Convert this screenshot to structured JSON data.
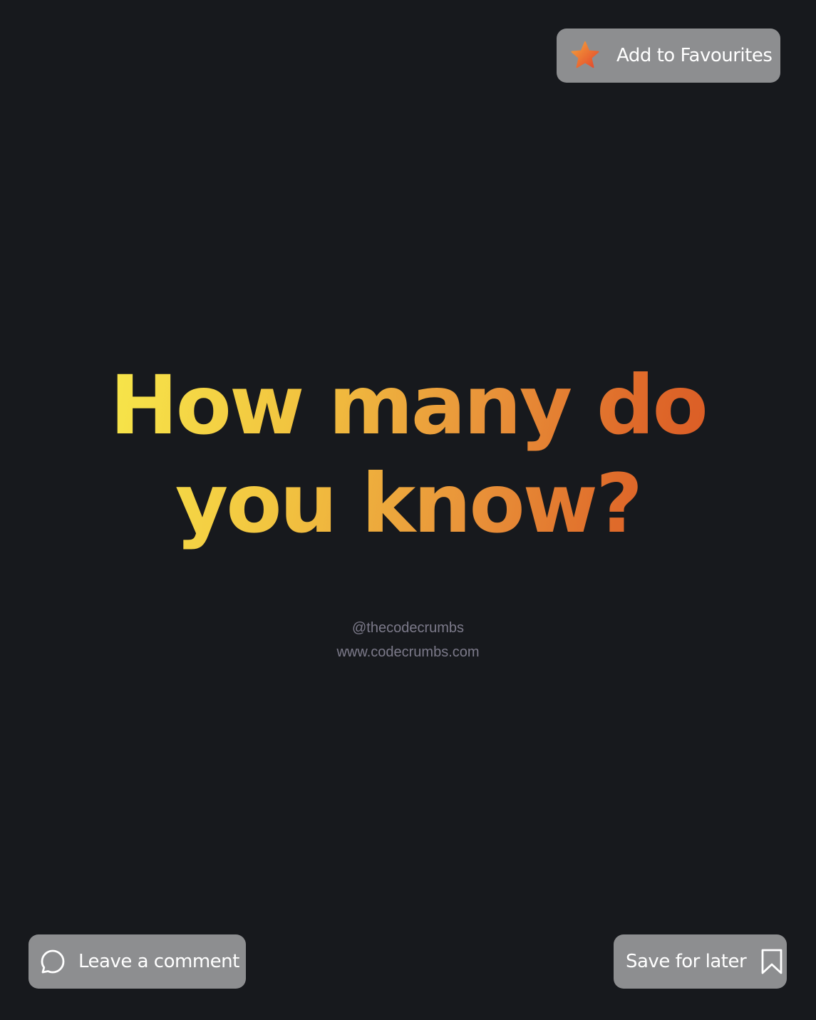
{
  "favourites_button": {
    "label": "Add to Favourites",
    "icon": "star-icon"
  },
  "headline": {
    "line1": "How many do",
    "line2": "you know?"
  },
  "credits": {
    "handle": "@thecodecrumbs",
    "url": "www.codecrumbs.com"
  },
  "comment_button": {
    "label": "Leave a comment",
    "icon": "speech-bubble-icon"
  },
  "save_button": {
    "label": "Save for later",
    "icon": "bookmark-icon"
  },
  "colors": {
    "background": "#17191d",
    "button": "#8d8e90",
    "gradient_start": "#f7e64a",
    "gradient_end": "#da5a25",
    "credit_text": "#7c7a8a"
  }
}
